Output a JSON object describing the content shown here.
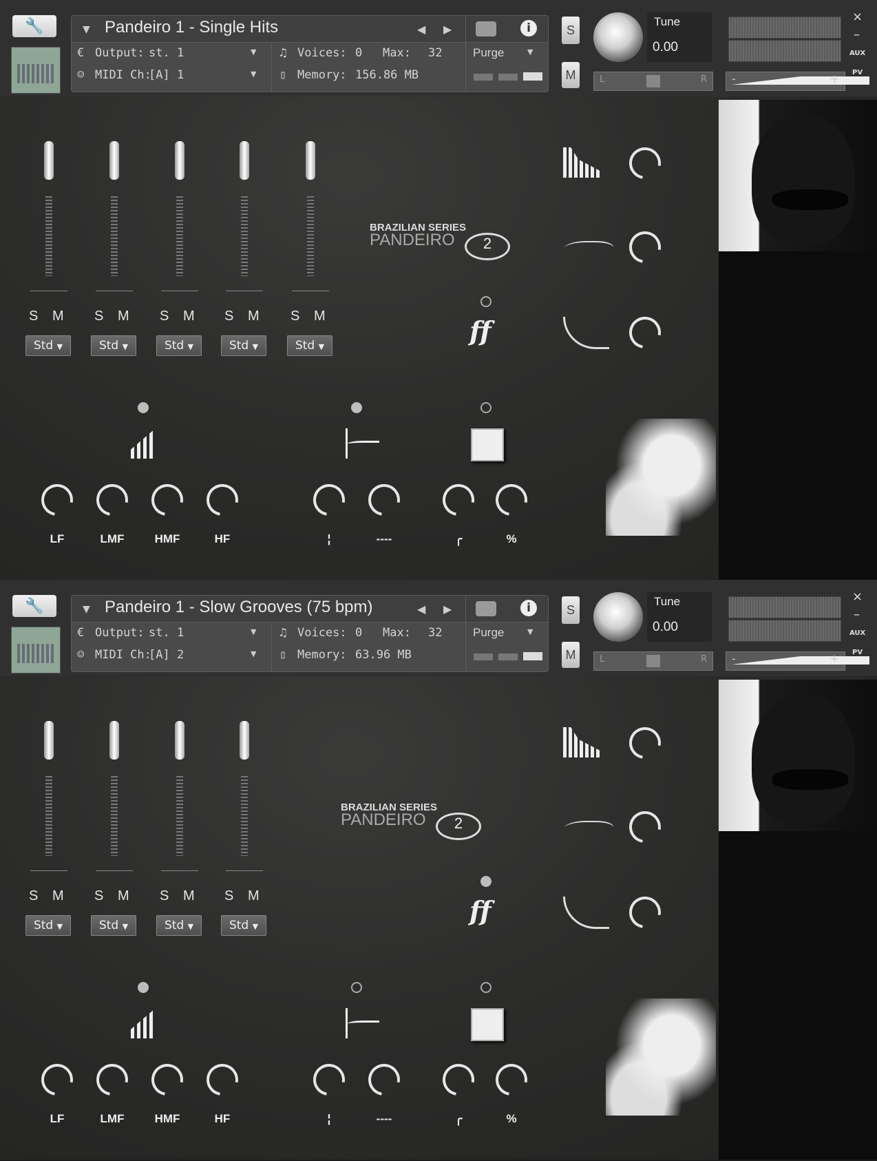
{
  "instruments": [
    {
      "title": "Pandeiro 1 - Single Hits",
      "output_label": "Output:",
      "output_value": "st. 1",
      "voices_label": "Voices:",
      "voices_value": "0",
      "max_label": "Max:",
      "max_value": "32",
      "purge_label": "Purge",
      "midi_label": "MIDI Ch:",
      "midi_value": "[A]  1",
      "memory_label": "Memory:",
      "memory_value": "156.86 MB",
      "s_btn": "S",
      "m_btn": "M",
      "tune_label": "Tune",
      "tune_value": "0.00",
      "pan_left": "L",
      "pan_right": "R",
      "vol_minus": "-",
      "vol_plus": "+",
      "aux_label": "AUX",
      "pv_label": "PV",
      "close_label": "×",
      "min_label": "–",
      "brand_top": "BRAZILIAN SERIES",
      "brand_bottom": "PANDEIRO",
      "brand_num": "2",
      "dyn_label": "ff",
      "channels": [
        {
          "s": "S",
          "m": "M",
          "mode": "Std"
        },
        {
          "s": "S",
          "m": "M",
          "mode": "Std"
        },
        {
          "s": "S",
          "m": "M",
          "mode": "Std"
        },
        {
          "s": "S",
          "m": "M",
          "mode": "Std"
        },
        {
          "s": "S",
          "m": "M",
          "mode": "Std"
        }
      ],
      "eq_labels": [
        "LF",
        "LMF",
        "HMF",
        "HF"
      ],
      "fx_labels": [
        "¦",
        "----",
        "╭",
        "%"
      ],
      "dots": {
        "eq": "on",
        "transient": "on",
        "reverb": "off",
        "dyn": "off"
      }
    },
    {
      "title": "Pandeiro 1 - Slow Grooves (75 bpm)",
      "output_label": "Output:",
      "output_value": "st. 1",
      "voices_label": "Voices:",
      "voices_value": "0",
      "max_label": "Max:",
      "max_value": "32",
      "purge_label": "Purge",
      "midi_label": "MIDI Ch:",
      "midi_value": "[A]  2",
      "memory_label": "Memory:",
      "memory_value": "63.96 MB",
      "s_btn": "S",
      "m_btn": "M",
      "tune_label": "Tune",
      "tune_value": "0.00",
      "pan_left": "L",
      "pan_right": "R",
      "vol_minus": "-",
      "vol_plus": "+",
      "aux_label": "AUX",
      "pv_label": "PV",
      "close_label": "×",
      "min_label": "–",
      "brand_top": "BRAZILIAN SERIES",
      "brand_bottom": "PANDEIRO",
      "brand_num": "2",
      "dyn_label": "ff",
      "channels": [
        {
          "s": "S",
          "m": "M",
          "mode": "Std"
        },
        {
          "s": "S",
          "m": "M",
          "mode": "Std"
        },
        {
          "s": "S",
          "m": "M",
          "mode": "Std"
        },
        {
          "s": "S",
          "m": "M",
          "mode": "Std"
        }
      ],
      "eq_labels": [
        "LF",
        "LMF",
        "HMF",
        "HF"
      ],
      "fx_labels": [
        "¦",
        "----",
        "╭",
        "%"
      ],
      "dots": {
        "eq": "on",
        "transient": "off",
        "reverb": "off",
        "dyn": "on"
      }
    }
  ]
}
